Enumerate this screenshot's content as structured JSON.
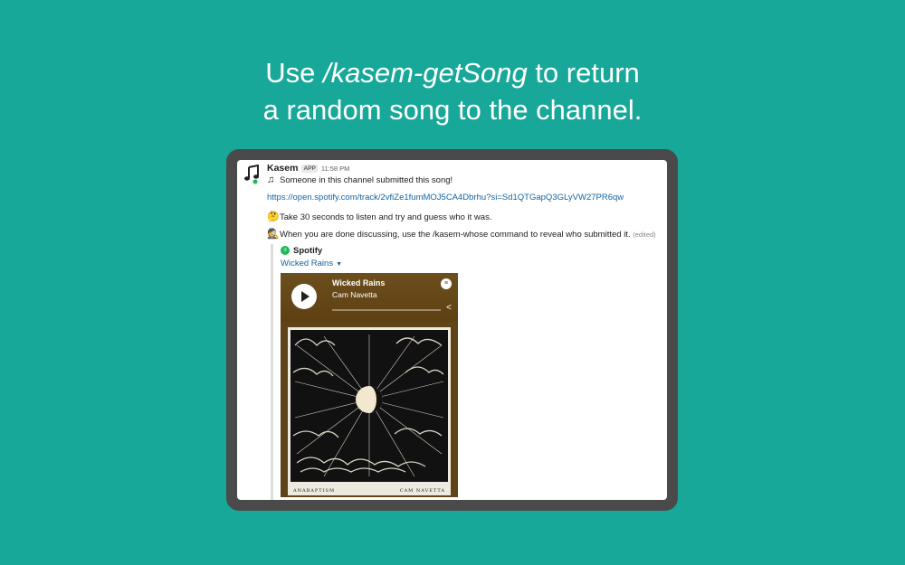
{
  "headline": {
    "prefix": "Use ",
    "command": "/kasem-getSong",
    "suffix": " to return",
    "line2": "a random song to the channel."
  },
  "message": {
    "author": "Kasem",
    "badge": "APP",
    "time": "11:58 PM",
    "line1": "Someone in this channel submitted this song!",
    "url": "https://open.spotify.com/track/2vfiZe1fumMOJ5CA4Dbrhu?si=Sd1QTGapQ3GLyVW27PR6qw",
    "line3": "Take 30 seconds to listen and try and guess who it was.",
    "line4": "When you are done discussing, use the /kasem-whose command to reveal who submitted it.",
    "edited": "(edited)"
  },
  "attachment": {
    "service": "Spotify",
    "track_link": "Wicked Rains",
    "player": {
      "title": "Wicked Rains",
      "artist": "Cam Navetta",
      "progress": 0
    },
    "cover": {
      "album": "ANABAPTISM",
      "artist": "CAM NAVETTA"
    }
  },
  "icons": {
    "avatar": "music-note-icon",
    "line1": "music-note-icon",
    "line3": "thinking-face-icon",
    "line4": "detective-icon"
  },
  "colors": {
    "background": "#17a899",
    "device": "#4a4a4a",
    "link": "#1264a3",
    "spotify": "#1db954",
    "player": "#6a4a16"
  }
}
